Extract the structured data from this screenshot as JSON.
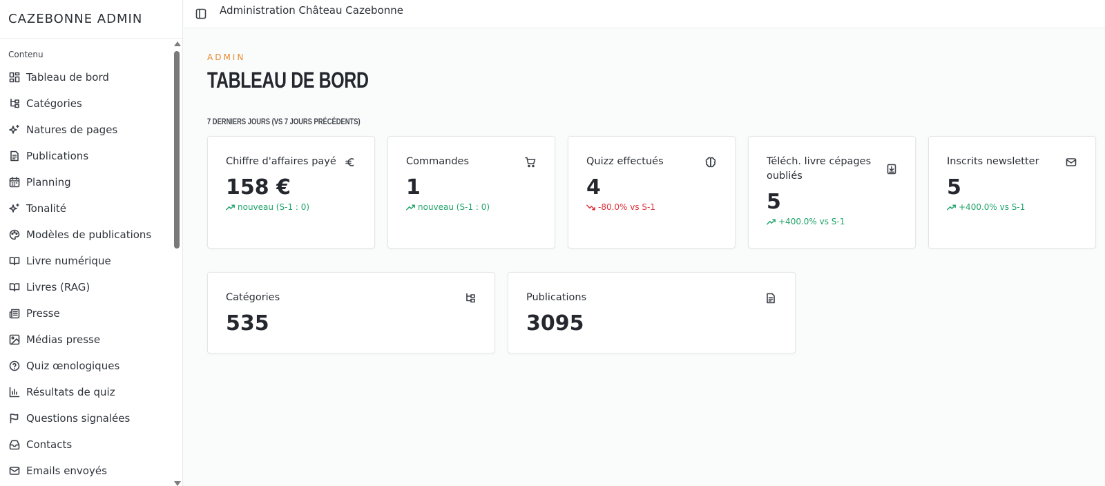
{
  "sidebar": {
    "brand": "CAZEBONNE ADMIN",
    "section": "Contenu",
    "items": [
      {
        "label": "Tableau de bord",
        "icon": "dashboard-icon"
      },
      {
        "label": "Catégories",
        "icon": "category-tree-icon"
      },
      {
        "label": "Natures de pages",
        "icon": "sparkles-icon"
      },
      {
        "label": "Publications",
        "icon": "document-icon"
      },
      {
        "label": "Planning",
        "icon": "calendar-icon"
      },
      {
        "label": "Tonalité",
        "icon": "sparkles-icon"
      },
      {
        "label": "Modèles de publications",
        "icon": "palette-icon"
      },
      {
        "label": "Livre numérique",
        "icon": "book-icon"
      },
      {
        "label": "Livres (RAG)",
        "icon": "book-icon"
      },
      {
        "label": "Presse",
        "icon": "newspaper-icon"
      },
      {
        "label": "Médias presse",
        "icon": "image-icon"
      },
      {
        "label": "Quiz œnologiques",
        "icon": "help-circle-icon"
      },
      {
        "label": "Résultats de quiz",
        "icon": "bar-chart-icon"
      },
      {
        "label": "Questions signalées",
        "icon": "flag-icon"
      },
      {
        "label": "Contacts",
        "icon": "inbox-icon"
      },
      {
        "label": "Emails envoyés",
        "icon": "mail-icon"
      }
    ]
  },
  "header": {
    "title": "Administration Château Cazebonne"
  },
  "main": {
    "eyebrow": "ADMIN",
    "title": "TABLEAU DE BORD",
    "period_label": "7 DERNIERS JOURS (VS 7 JOURS PRÉCÉDENTS)",
    "kpis": [
      {
        "label": "Chiffre d'affaires payé",
        "icon": "euro-icon",
        "value": "158 €",
        "delta": "nouveau (S-1 : 0)",
        "trend": "up"
      },
      {
        "label": "Commandes",
        "icon": "cart-icon",
        "value": "1",
        "delta": "nouveau (S-1 : 0)",
        "trend": "up"
      },
      {
        "label": "Quizz effectués",
        "icon": "brain-icon",
        "value": "4",
        "delta": "-80.0% vs S-1",
        "trend": "down"
      },
      {
        "label": "Téléch. livre cépages oubliés",
        "icon": "download-file-icon",
        "value": "5",
        "delta": "+400.0% vs S-1",
        "trend": "up"
      },
      {
        "label": "Inscrits newsletter",
        "icon": "mail-icon",
        "value": "5",
        "delta": "+400.0% vs S-1",
        "trend": "up"
      }
    ],
    "stats": [
      {
        "label": "Catégories",
        "icon": "category-tree-icon",
        "value": "535"
      },
      {
        "label": "Publications",
        "icon": "document-icon",
        "value": "3095"
      }
    ]
  },
  "colors": {
    "accent": "#e58a2e",
    "up": "#21a46a",
    "down": "#e0303a"
  }
}
